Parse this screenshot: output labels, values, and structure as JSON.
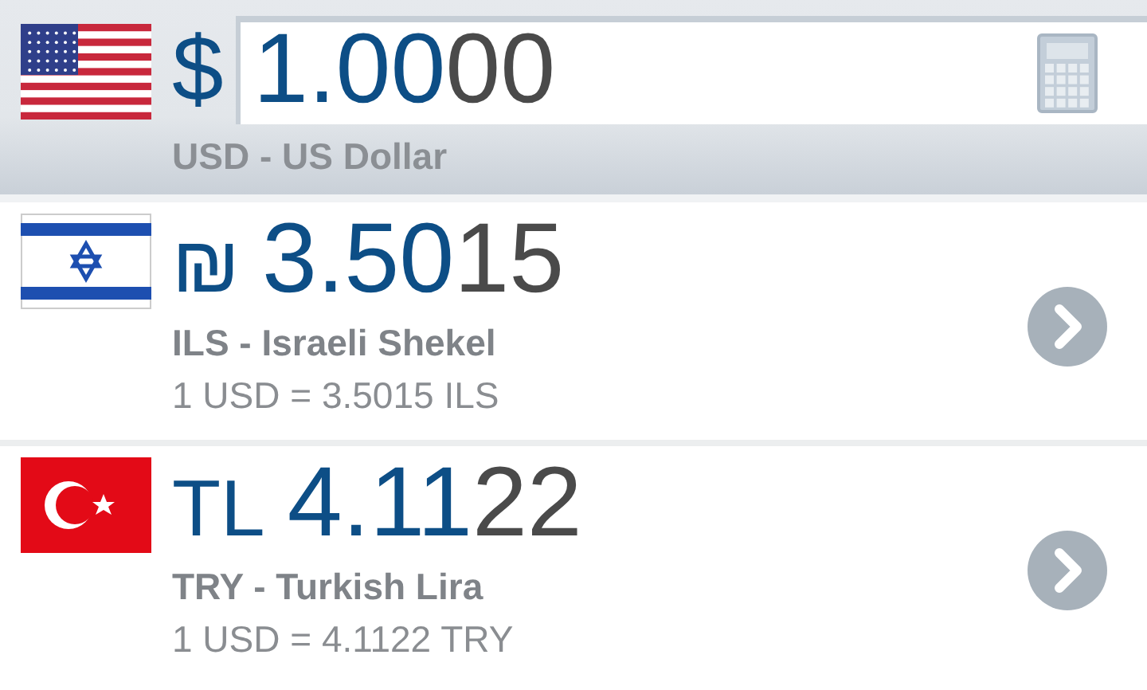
{
  "base": {
    "kind": "us",
    "symbol": "$",
    "value_lead": "1.00",
    "value_tail": "00",
    "name": "USD - US Dollar"
  },
  "rows": [
    {
      "kind": "il",
      "symbol": "₪",
      "amount_lead": "3.50",
      "amount_tail": "15",
      "name": "ILS - Israeli Shekel",
      "rate": "1 USD = 3.5015 ILS"
    },
    {
      "kind": "tr",
      "symbol": "TL",
      "amount_lead": "4.11",
      "amount_tail": "22",
      "name": "TRY - Turkish Lira",
      "rate": "1 USD = 4.1122 TRY"
    }
  ]
}
